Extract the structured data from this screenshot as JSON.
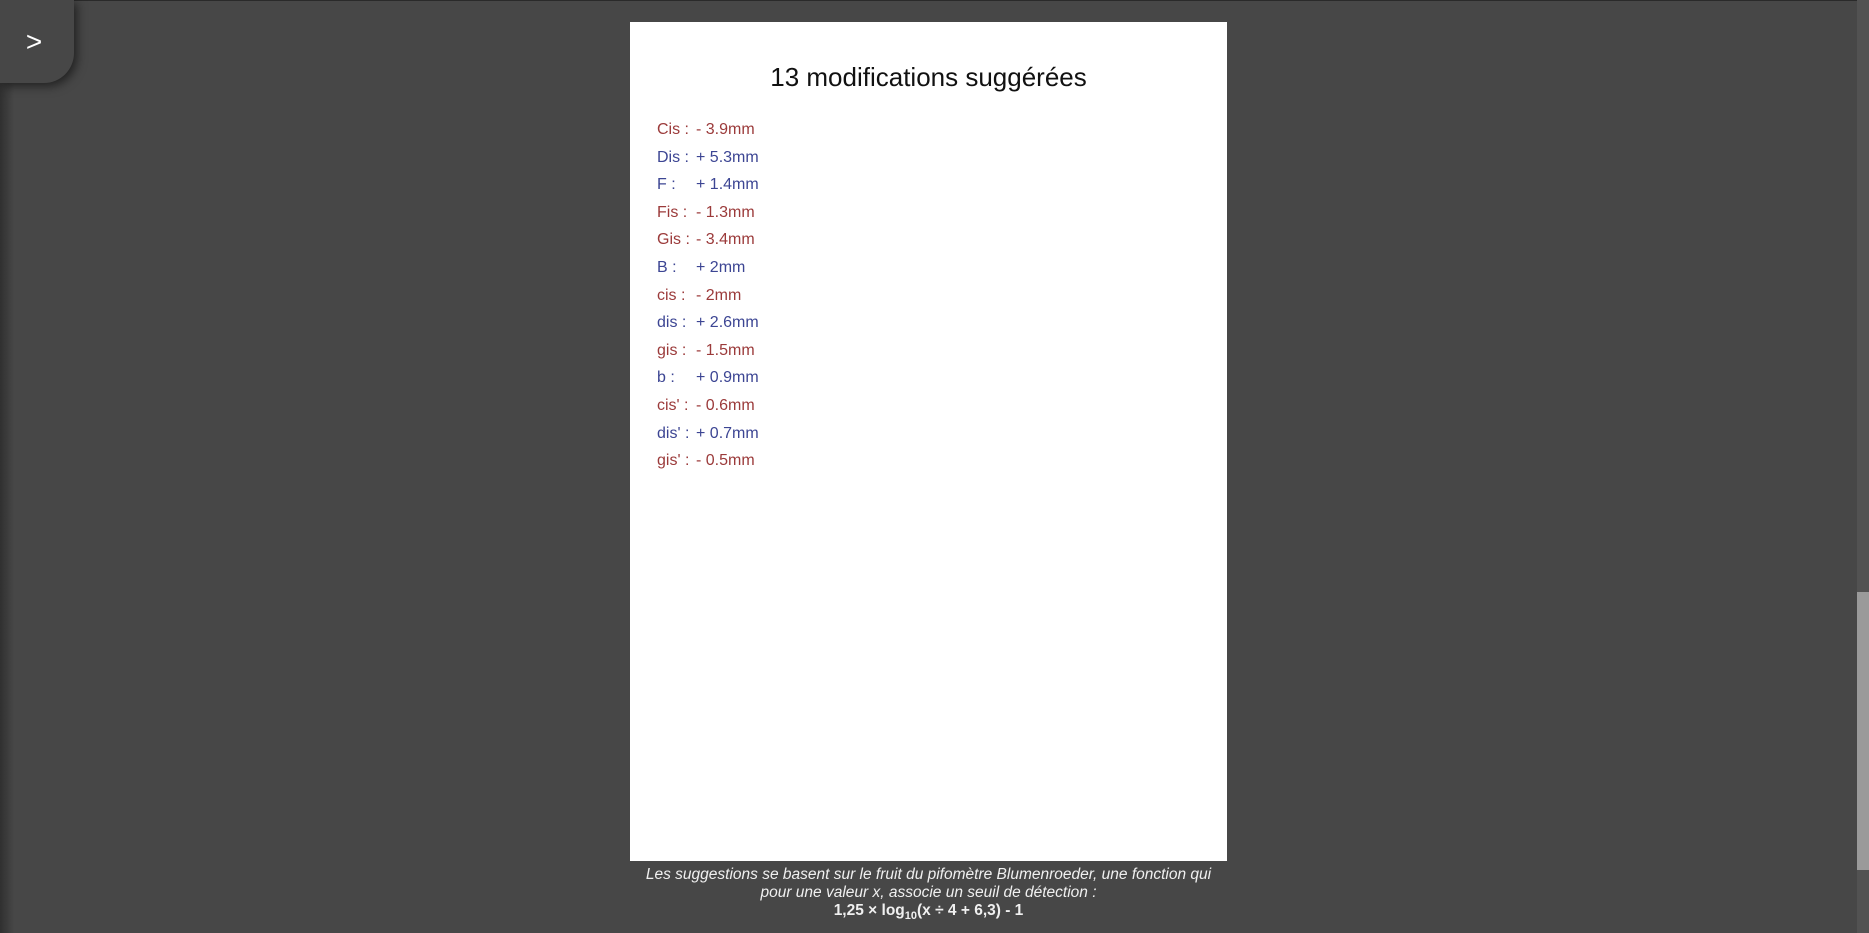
{
  "sidebar_toggle": {
    "label": ">",
    "icon": "chevron-right-icon"
  },
  "page": {
    "title": "13 modifications suggérées",
    "modifications": [
      {
        "note": "Cis",
        "sign": "-",
        "value": "3.9mm",
        "direction": "minus"
      },
      {
        "note": "Dis",
        "sign": "+",
        "value": "5.3mm",
        "direction": "plus"
      },
      {
        "note": "F",
        "sign": "+",
        "value": "1.4mm",
        "direction": "plus"
      },
      {
        "note": "Fis",
        "sign": "-",
        "value": "1.3mm",
        "direction": "minus"
      },
      {
        "note": "Gis",
        "sign": "-",
        "value": "3.4mm",
        "direction": "minus"
      },
      {
        "note": "B",
        "sign": "+",
        "value": "2mm",
        "direction": "plus"
      },
      {
        "note": "cis",
        "sign": "-",
        "value": "2mm",
        "direction": "minus"
      },
      {
        "note": "dis",
        "sign": "+",
        "value": "2.6mm",
        "direction": "plus"
      },
      {
        "note": "gis",
        "sign": "-",
        "value": "1.5mm",
        "direction": "minus"
      },
      {
        "note": "b",
        "sign": "+",
        "value": "0.9mm",
        "direction": "plus"
      },
      {
        "note": "cis'",
        "sign": "-",
        "value": "0.6mm",
        "direction": "minus"
      },
      {
        "note": "dis'",
        "sign": "+",
        "value": "0.7mm",
        "direction": "plus"
      },
      {
        "note": "gis'",
        "sign": "-",
        "value": "0.5mm",
        "direction": "minus"
      }
    ]
  },
  "caption": {
    "line1": "Les suggestions se basent sur le fruit du pifomètre Blumenroeder, une fonction qui",
    "line2": "pour une valeur x, associe un seuil de détection :",
    "formula_prefix": "1,25 × log",
    "formula_sub": "10",
    "formula_suffix": "(x ÷ 4 + 6,3) - 1"
  },
  "colors": {
    "background": "#474747",
    "minus": "#9b3a3a",
    "plus": "#3c4593",
    "page": "#ffffff"
  },
  "scroll": {
    "position_fraction": 0.98
  }
}
